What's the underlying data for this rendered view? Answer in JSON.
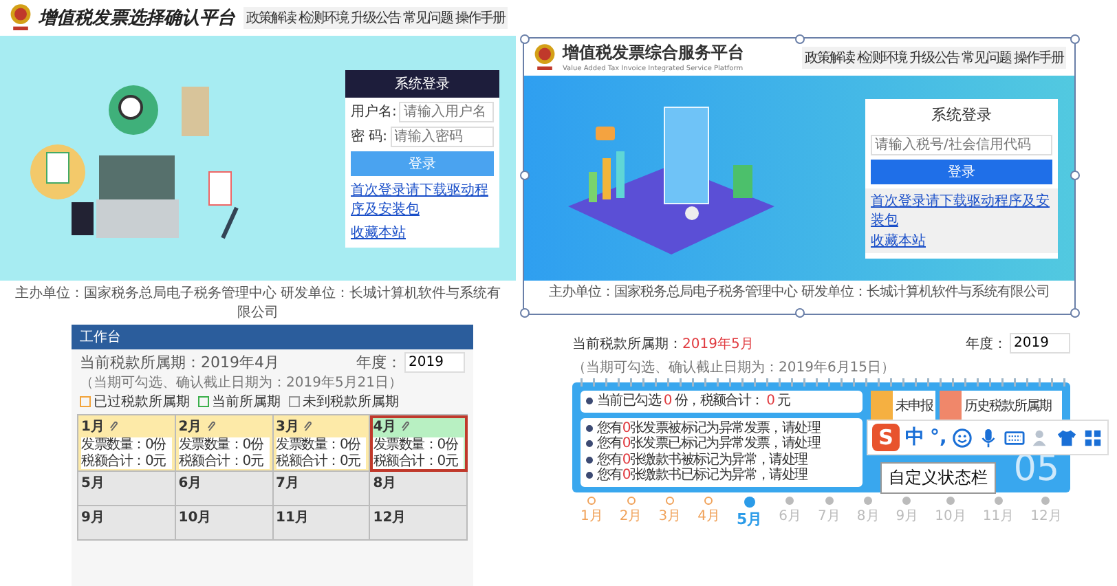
{
  "login_page_old": {
    "title": "增值税发票选择确认平台",
    "nav": [
      "政策解读",
      "检测环境",
      "升级公告",
      "常见问题",
      "操作手册"
    ],
    "login": {
      "heading": "系统登录",
      "username_label": "用户名:",
      "username_placeholder": "请输入用户名",
      "password_label": "密 码:",
      "password_placeholder": "请输入密码",
      "button": "登录",
      "links": [
        "首次登录请下载驱动程序及安装包",
        "收藏本站"
      ]
    },
    "footer": [
      "主办单位：国家税务总局电子税务管理中心  研发单位：长城计算机软件与系统有限公司"
    ]
  },
  "login_page_new": {
    "title": "增值税发票综合服务平台",
    "subtitle": "Value Added Tax Invoice Integrated Service Platform",
    "nav": [
      "政策解读",
      "检测环境",
      "升级公告",
      "常见问题",
      "操作手册"
    ],
    "login": {
      "heading": "系统登录",
      "placeholder": "请输入税号/社会信用代码",
      "button": "登录",
      "links": [
        "首次登录请下载驱动程序及安装包",
        "收藏本站"
      ]
    },
    "footer": "主办单位：国家税务总局电子税务管理中心  研发单位：长城计算机软件与系统有限公司"
  },
  "workbench_old": {
    "header": "工作台",
    "period_label": "当前税款所属期：2019年4月",
    "note": "（当期可勾选、确认截止日期为：2019年5月21日）",
    "legend": [
      {
        "label": "已过税款所属期",
        "kind": "past"
      },
      {
        "label": "当前所属期",
        "kind": "current"
      },
      {
        "label": "未到税款所属期",
        "kind": "future"
      }
    ],
    "year_label": "年度：",
    "year_value": "2019",
    "months": [
      {
        "label": "1月",
        "kind": "past",
        "selected": false,
        "details": [
          "发票数量：0份",
          "税额合计：0元"
        ]
      },
      {
        "label": "2月",
        "kind": "past",
        "selected": false,
        "details": [
          "发票数量：0份",
          "税额合计：0元"
        ]
      },
      {
        "label": "3月",
        "kind": "past",
        "selected": false,
        "details": [
          "发票数量：0份",
          "税额合计：0元"
        ]
      },
      {
        "label": "4月",
        "kind": "current",
        "selected": true,
        "details": [
          "发票数量：0份",
          "税额合计：0元"
        ]
      },
      {
        "label": "5月",
        "kind": "future",
        "selected": false
      },
      {
        "label": "6月",
        "kind": "future",
        "selected": false
      },
      {
        "label": "7月",
        "kind": "future",
        "selected": false
      },
      {
        "label": "8月",
        "kind": "future",
        "selected": false
      },
      {
        "label": "9月",
        "kind": "future",
        "selected": false
      },
      {
        "label": "10月",
        "kind": "future",
        "selected": false
      },
      {
        "label": "11月",
        "kind": "future",
        "selected": false
      },
      {
        "label": "12月",
        "kind": "future",
        "selected": false
      }
    ]
  },
  "workbench_new": {
    "period_label": "当前税款所属期：",
    "period_value": "2019年5月",
    "note": "（当期可勾选、确认截止日期为：2019年6月15日）",
    "year_label": "年度：",
    "year_value": "2019",
    "summary": [
      {
        "text": "当前已勾选",
        "kind": "text"
      },
      {
        "text": "0",
        "kind": "count"
      },
      {
        "text": "份，税额合计：",
        "kind": "text"
      },
      {
        "text": "0",
        "kind": "count"
      },
      {
        "text": "元",
        "kind": "text"
      }
    ],
    "notices": [
      {
        "before": "您有",
        "count": "0",
        "after": "张发票被标记为异常发票，请处理"
      },
      {
        "before": "您有",
        "count": "0",
        "after": "张发票已标记为异常发票，请处理"
      },
      {
        "before": "您有",
        "count": "0",
        "after": "张缴款书被标记为异常，请处理"
      },
      {
        "before": "您有",
        "count": "0",
        "after": "张缴款书已标记为异常，请处理"
      }
    ],
    "tiles": [
      {
        "label": "未申报",
        "color": "#f5b041"
      },
      {
        "label": "历史税款所属期",
        "color": "#f0876a"
      }
    ],
    "big_day": "05",
    "timeline": [
      {
        "label": "1月",
        "kind": "past",
        "selected": false
      },
      {
        "label": "2月",
        "kind": "past",
        "selected": false
      },
      {
        "label": "3月",
        "kind": "past",
        "selected": false
      },
      {
        "label": "4月",
        "kind": "past",
        "selected": false
      },
      {
        "label": "5月",
        "kind": "current",
        "selected": true
      },
      {
        "label": "6月",
        "kind": "future",
        "selected": false
      },
      {
        "label": "7月",
        "kind": "future",
        "selected": false
      },
      {
        "label": "8月",
        "kind": "future",
        "selected": false
      },
      {
        "label": "9月",
        "kind": "future",
        "selected": false
      },
      {
        "label": "10月",
        "kind": "future",
        "selected": false
      },
      {
        "label": "11月",
        "kind": "future",
        "selected": false
      },
      {
        "label": "12月",
        "kind": "future",
        "selected": false
      }
    ]
  },
  "ime_toolbar": {
    "buttons": [
      {
        "kind": "logo",
        "label": "S"
      },
      {
        "kind": "text",
        "label": "中"
      },
      {
        "kind": "text",
        "label": "°,"
      },
      {
        "kind": "smiley"
      },
      {
        "kind": "mic"
      },
      {
        "kind": "keyboard"
      },
      {
        "kind": "user"
      },
      {
        "kind": "shirt"
      },
      {
        "kind": "grid"
      }
    ],
    "tooltip": "自定义状态栏"
  }
}
